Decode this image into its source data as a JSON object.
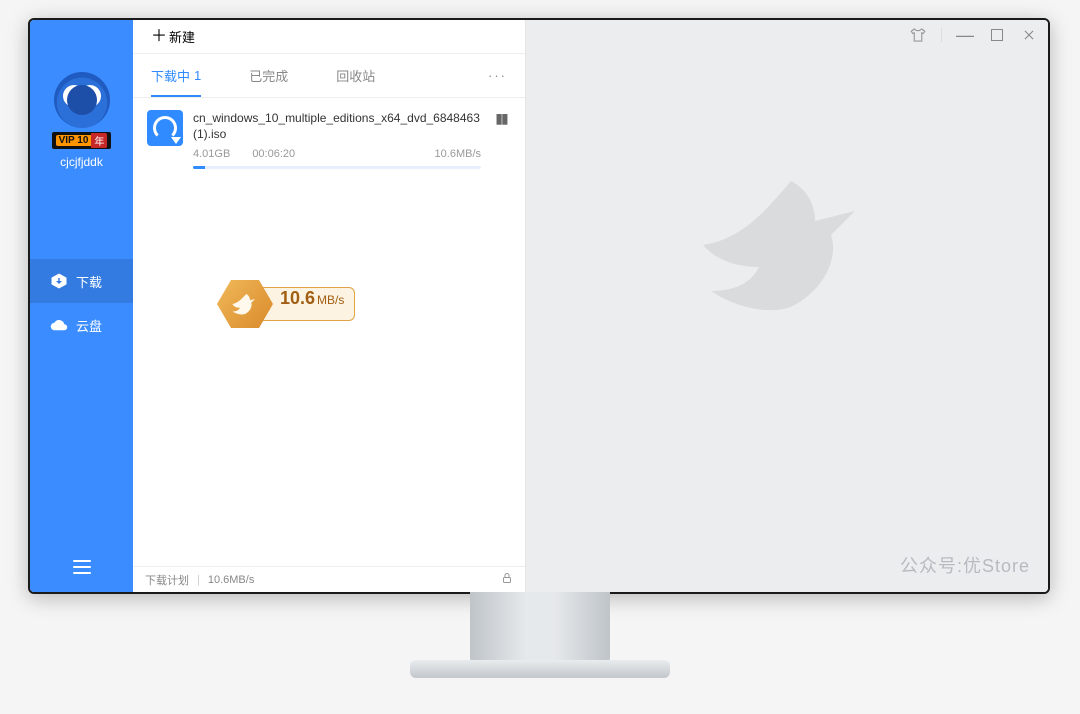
{
  "toolbar": {
    "new_label": "新建"
  },
  "user": {
    "name": "cjcjfjddk",
    "vip_left": "VIP 10",
    "vip_right": "年"
  },
  "nav": {
    "download": "下载",
    "cloud": "云盘"
  },
  "tabs": {
    "downloading": "下载中",
    "downloading_count": "1",
    "completed": "已完成",
    "recycle": "回收站",
    "more": "···"
  },
  "download": {
    "title": "cn_windows_10_multiple_editions_x64_dvd_6848463(1).iso",
    "size": "4.01GB",
    "eta": "00:06:20",
    "speed": "10.6MB/s",
    "progress_percent": 4
  },
  "speed_badge": {
    "value": "10.6",
    "unit": "MB/s"
  },
  "statusbar": {
    "plan": "下载计划",
    "speed": "10.6MB/s"
  },
  "watermark": "公众号:优Store"
}
